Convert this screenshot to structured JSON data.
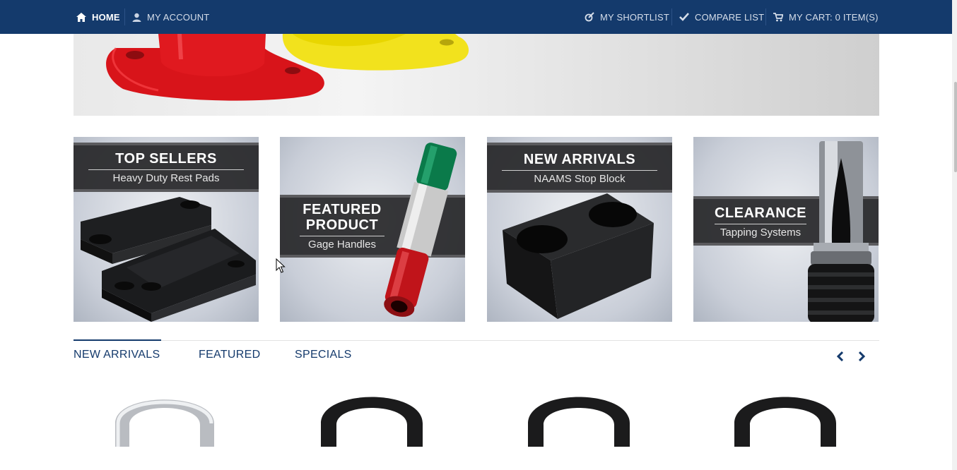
{
  "nav": {
    "home": "HOME",
    "account": "MY ACCOUNT",
    "shortlist": "MY SHORTLIST",
    "compare": "COMPARE LIST",
    "cart": "MY CART: 0 ITEM(S)"
  },
  "tiles": [
    {
      "heading": "TOP SELLERS",
      "sub": "Heavy Duty Rest Pads"
    },
    {
      "heading1": "FEATURED",
      "heading2": "PRODUCT",
      "sub": "Gage Handles"
    },
    {
      "heading": "NEW ARRIVALS",
      "sub": "NAAMS Stop Block"
    },
    {
      "heading": "CLEARANCE",
      "sub": "Tapping Systems"
    }
  ],
  "tabs": [
    "NEW ARRIVALS",
    "FEATURED",
    "SPECIALS"
  ],
  "colors": {
    "nav_bg": "#143a6c",
    "accent": "#143a6c"
  },
  "icons": [
    "home-icon",
    "user-icon",
    "shortlist-icon",
    "check-icon",
    "cart-icon",
    "chevron-left-icon",
    "chevron-right-icon"
  ]
}
